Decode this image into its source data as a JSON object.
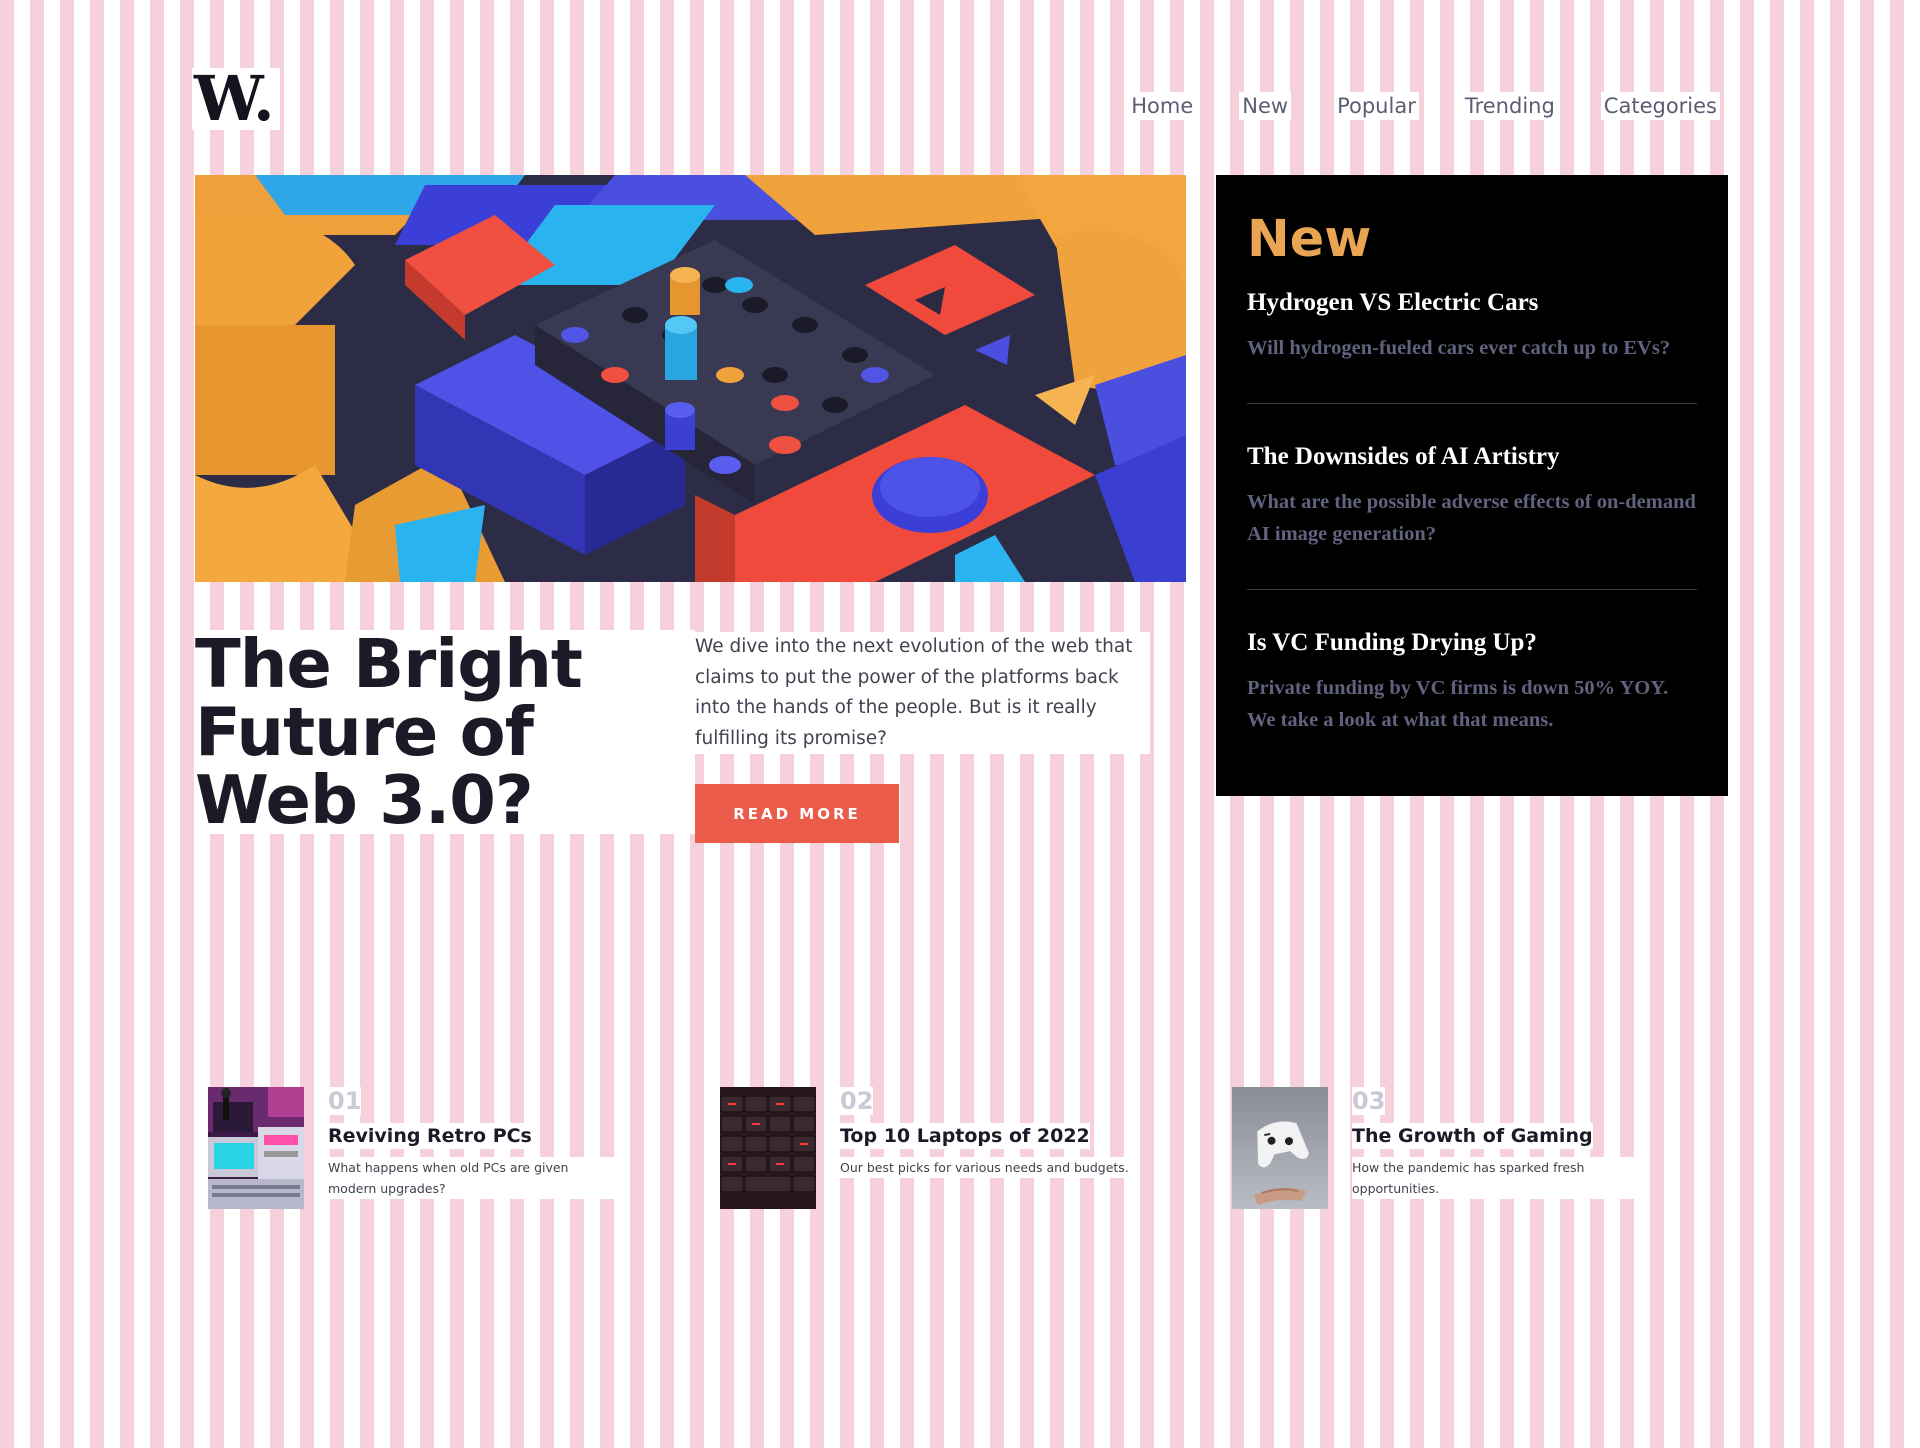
{
  "brand": {
    "logo": "W."
  },
  "nav": [
    "Home",
    "New",
    "Popular",
    "Trending",
    "Categories"
  ],
  "hero": {
    "title": "The Bright Future of Web 3.0?",
    "description": "We dive into the next evolution of the web that claims to put the power of the platforms back into the hands of the people. But is it really fulfilling its promise?",
    "cta": "READ MORE"
  },
  "new_panel": {
    "heading": "New",
    "items": [
      {
        "title": "Hydrogen VS Electric Cars",
        "desc": "Will hydrogen-fueled cars ever catch up to EVs?"
      },
      {
        "title": "The Downsides of AI Artistry",
        "desc": "What are the possible adverse effects of on-demand AI image generation?"
      },
      {
        "title": "Is VC Funding Drying Up?",
        "desc": "Private funding by VC firms is down 50% YOY. We take a look at what that means."
      }
    ]
  },
  "cards": [
    {
      "num": "01",
      "title": "Reviving Retro PCs",
      "desc": "What happens when old PCs are given modern upgrades?"
    },
    {
      "num": "02",
      "title": "Top 10 Laptops of 2022",
      "desc": "Our best picks for various needs and budgets."
    },
    {
      "num": "03",
      "title": "The Growth of Gaming",
      "desc": "How the pandemic has sparked fresh opportunities."
    }
  ],
  "colors": {
    "accent_button": "#ea5b4a",
    "new_heading": "#eaa553",
    "panel_bg": "#000000",
    "muted_text": "#60627e"
  }
}
